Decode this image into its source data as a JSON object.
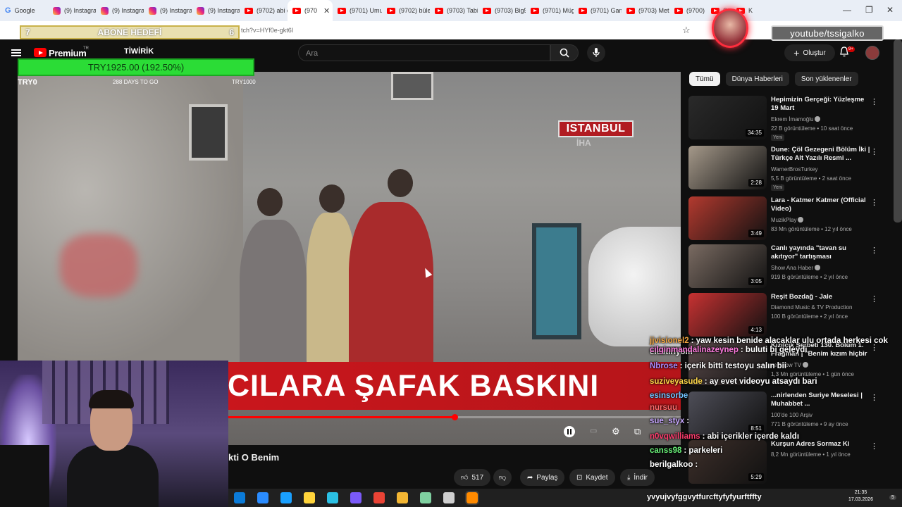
{
  "browser": {
    "tabs": [
      {
        "label": "Google",
        "type": "g"
      },
      {
        "label": "(9) Instagra",
        "type": "ig"
      },
      {
        "label": "(9) Instagra",
        "type": "ig"
      },
      {
        "label": "(9) Instagra",
        "type": "ig"
      },
      {
        "label": "(9) Instagra",
        "type": "ig"
      },
      {
        "label": "(9702) abi d",
        "type": "yt"
      },
      {
        "label": "(970",
        "type": "yt",
        "active": true
      },
      {
        "label": "(9701) Umu",
        "type": "yt"
      },
      {
        "label": "(9702) büle",
        "type": "yt"
      },
      {
        "label": "(9703) Tabi",
        "type": "yt"
      },
      {
        "label": "(9703) Big5",
        "type": "yt"
      },
      {
        "label": "(9701) Müg",
        "type": "yt"
      },
      {
        "label": "(9701) Gam",
        "type": "yt"
      },
      {
        "label": "(9703) Met",
        "type": "yt"
      },
      {
        "label": "(9700) TP",
        "type": "yt"
      },
      {
        "label": "Stre",
        "type": "yt"
      },
      {
        "label": "Kı",
        "type": "yt"
      }
    ],
    "url": "tch?v=HYf0e-gkt6I",
    "window_min": "—",
    "window_max": "❐",
    "window_close": "✕"
  },
  "overlay": {
    "abone_count_left": "7",
    "abone_label": "ABONE HEDEFİ",
    "abone_count_right": "6",
    "goal_amount": "TRY1925.00 (192.50%)",
    "goal_min": "TRY0",
    "goal_days": "288 DAYS TO GO",
    "goal_max": "TRY1000",
    "handle": "youtube/tssigalko"
  },
  "youtube": {
    "premium": "Premium",
    "premium_tr": "TR",
    "channel_overlay": "TİWİRİK",
    "search_placeholder": "Ara",
    "create": "Oluştur",
    "notif_badge": "9+"
  },
  "video": {
    "location_badge": "ISTANBUL",
    "agency": "İHA",
    "banner": "CILARA ŞAFAK BASKINI",
    "title": "kti O Benim",
    "progress": 0.5
  },
  "actions": {
    "like_count": "517",
    "share": "Paylaş",
    "save": "Kaydet",
    "download": "İndir"
  },
  "chips": [
    "Tümü",
    "Dünya Haberleri",
    "Son yüklenenler"
  ],
  "recommendations": [
    {
      "title": "Hepimizin Gerçeği: Yüzleşme 19 Mart",
      "channel": "Ekrem İmamoğlu",
      "verified": true,
      "views": "22 B görüntüleme • 10 saat önce",
      "badge": "Yeni",
      "duration": "34:35",
      "thumb": "#2a2a2a"
    },
    {
      "title": "Dune: Çöl Gezegeni Bölüm İki | Türkçe Alt Yazılı Resmi ...",
      "channel": "WarnerBrosTurkey",
      "verified": false,
      "views": "5,5 B görüntüleme • 2 saat önce",
      "badge": "Yeni",
      "duration": "2:28",
      "thumb": "#a5998a"
    },
    {
      "title": "Lara - Katmer Katmer (Official Video)",
      "channel": "MuzikPlay",
      "verified": true,
      "views": "83 Mn görüntüleme • 12 yıl önce",
      "badge": "",
      "duration": "3:49",
      "thumb": "#b33a2f"
    },
    {
      "title": "Canlı yayında \"tavan su akıtıyor\" tartışması",
      "channel": "Show Ana Haber",
      "verified": true,
      "views": "919 B görüntüleme • 2 yıl önce",
      "badge": "",
      "duration": "3:05",
      "thumb": "#7a6b62"
    },
    {
      "title": "Reşit Bozdağ - Jale",
      "channel": "Diamond Music & TV Production",
      "verified": false,
      "views": "100 B görüntüleme • 2 yıl önce",
      "badge": "",
      "duration": "4:13",
      "thumb": "#c83232"
    },
    {
      "title": "Kızılcık Şerbeti 130. Bölüm 1. Fragman | \"Benim kızım hiçbir ...",
      "channel": "ve Show TV",
      "verified": true,
      "views": "1,3 Mn görüntüleme • 1 gün önce",
      "badge": "",
      "duration": "",
      "thumb": "#5a4a4a"
    },
    {
      "title": "...nirlenden Suriye Meselesi | Muhabbet ...",
      "channel": "100'de 100 Arşiv",
      "verified": false,
      "views": "771 B görüntüleme • 9 ay önce",
      "badge": "",
      "duration": "8:51",
      "thumb": "#4e4e58"
    },
    {
      "title": "Kurşun Adres Sormaz Ki",
      "channel": "",
      "verified": false,
      "views": "8,2 Mn görüntüleme • 1 yıl önce",
      "badge": "",
      "duration": "5:29",
      "thumb": "#3d2f2a"
    }
  ],
  "chat": [
    {
      "user": "jjvisionel2",
      "color": "#f4a640",
      "text": ": yaw kesin benide alacaklar ulu ortada herkesi cok elestiriyom"
    },
    {
      "user": "cilginmandalinazeynep",
      "color": "#ff7adf",
      "text": ": buluti bi geleydi"
    },
    {
      "user": "Nbrose",
      "color": "#a98bff",
      "text": ": içerik bitti testoyu salın bii"
    },
    {
      "user": "suziveyasude",
      "color": "#ffd84a",
      "text": ": ay evet videoyu atsaydı bari"
    },
    {
      "user": "esinsorbe",
      "color": "#6fc3ff",
      "text": ""
    },
    {
      "user": "nursuu",
      "color": "#ff6b6b",
      "text": ""
    },
    {
      "user": "sue_styx",
      "color": "#c7a6ff",
      "text": ":"
    },
    {
      "user": "n0vqwilliams",
      "color": "#ff3d6e",
      "text": ": abi içerikler içerde kaldı"
    },
    {
      "user": "canss98",
      "color": "#6af57a",
      "text": ": parkeleri"
    },
    {
      "user": "berilgalkoo",
      "color": "#ffffff",
      "text": ":"
    }
  ],
  "bottom_chat": "yvyujvyfggvytfurcftyfyfyurftffty",
  "taskbar": {
    "time": "21:35",
    "date": "17.03.2026",
    "notif": "5",
    "icons": [
      "#0b7bd8",
      "#2a8cff",
      "#1aa0ff",
      "#ffd43b",
      "#2bc0e4",
      "#7a5af8",
      "#ea4335",
      "#f3b633",
      "#7fd0a0",
      "#cfcfcf",
      "#ff8a00"
    ]
  },
  "colors": {
    "yt_red": "#ff0000",
    "accent_green": "#2bdc36",
    "news_red": "#c9161c"
  }
}
